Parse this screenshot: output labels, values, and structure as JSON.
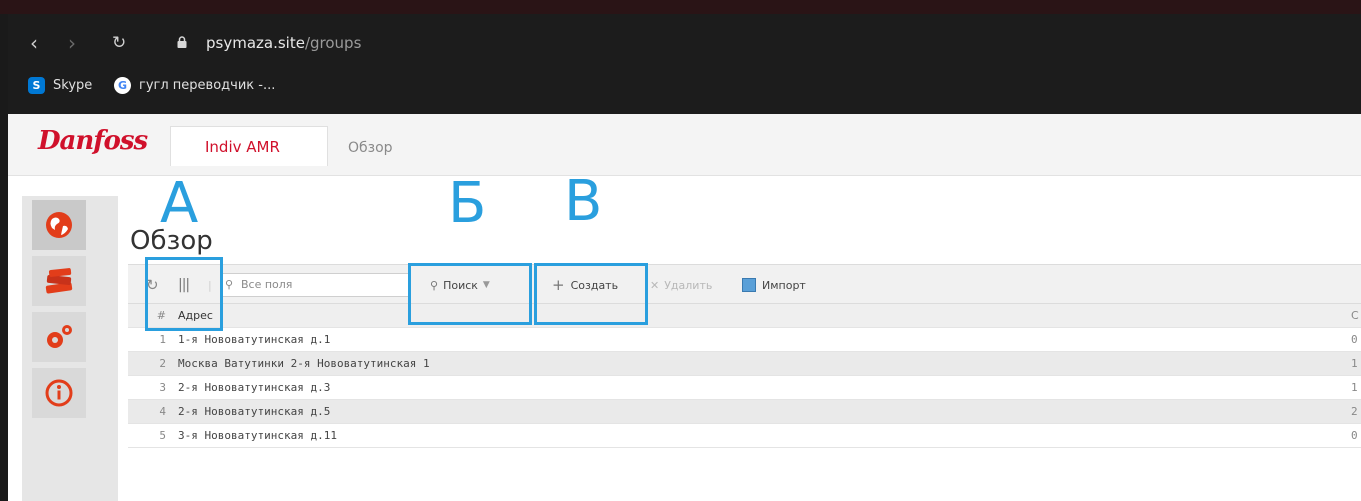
{
  "browser": {
    "url_host": "psymaza.site",
    "url_path": "/groups",
    "bookmarks": [
      {
        "label": "Skype",
        "icon": "skype-icon",
        "color": "#0078d4"
      },
      {
        "label": "гугл переводчик -...",
        "icon": "google-icon",
        "color": "#ffffff"
      }
    ]
  },
  "app": {
    "logo": "Danfoss",
    "tabs": [
      {
        "label": "Indiv AMR",
        "active": true
      },
      {
        "label": "Обзор",
        "active": false
      }
    ],
    "accent": "#d0102b",
    "sidebar": {
      "items": [
        {
          "icon": "globe-icon"
        },
        {
          "icon": "books-icon"
        },
        {
          "icon": "gears-icon"
        },
        {
          "icon": "info-icon"
        }
      ]
    },
    "page_title": "Обзор",
    "toolbar": {
      "search_placeholder": "Все поля",
      "search_button": "Поиск",
      "create_button": "Создать",
      "delete_button": "Удалить",
      "import_button": "Импорт"
    },
    "table": {
      "header_num": "#",
      "header_address": "Адрес",
      "header_right": "С",
      "rows": [
        {
          "num": "1",
          "address": "1-я Нововатутинская д.1",
          "right": "0"
        },
        {
          "num": "2",
          "address": "Москва Ватутинки 2-я Нововатутинская 1",
          "right": "1"
        },
        {
          "num": "3",
          "address": "2-я Нововатутинская д.3",
          "right": "1"
        },
        {
          "num": "4",
          "address": "2-я Нововатутинская д.5",
          "right": "2"
        },
        {
          "num": "5",
          "address": "3-я Нововатутинская д.11",
          "right": "0"
        }
      ]
    }
  },
  "annotations": {
    "a": "А",
    "b": "Б",
    "v": "В",
    "color": "#2a9fde"
  }
}
